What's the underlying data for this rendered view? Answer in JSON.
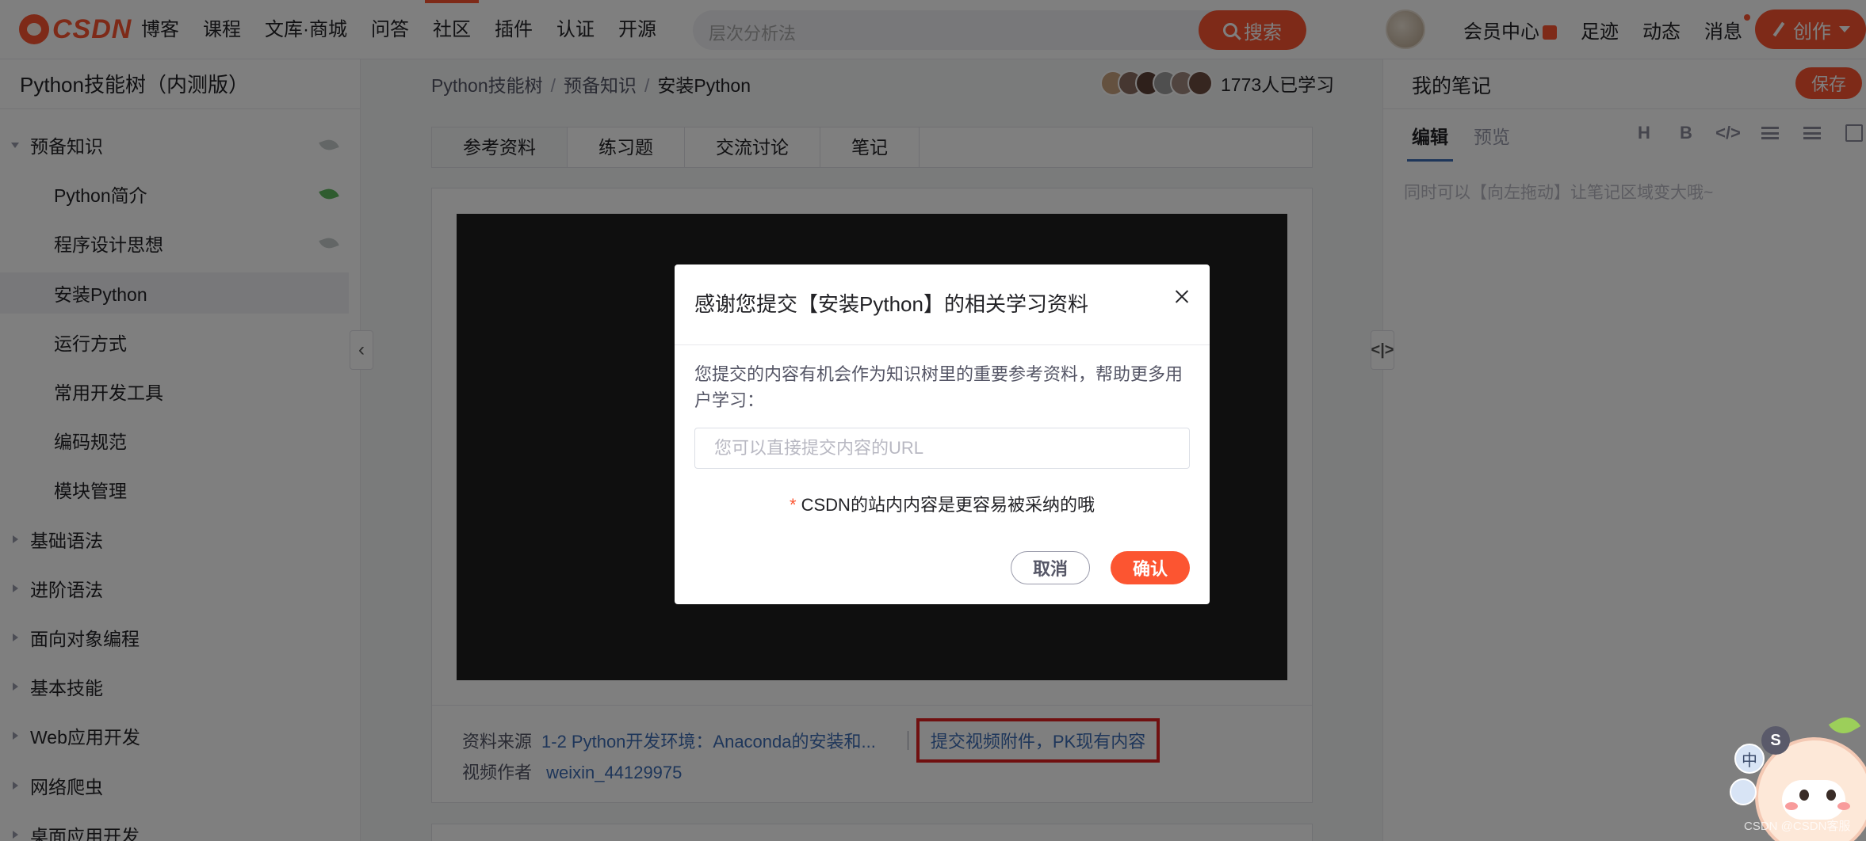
{
  "nav": {
    "logo": "CSDN",
    "links": [
      "博客",
      "课程",
      "文库·商城",
      "问答",
      "社区",
      "插件",
      "认证",
      "开源"
    ],
    "active_link": "社区",
    "search_placeholder": "层次分析法",
    "search_button": "搜索",
    "right_links": [
      "会员中心",
      "足迹",
      "动态",
      "消息"
    ],
    "create_button": "创作"
  },
  "sidebar": {
    "title": "Python技能树（内测版）",
    "items": [
      {
        "label": "预备知识",
        "level": 0,
        "expanded": true,
        "leaf": "grey"
      },
      {
        "label": "Python简介",
        "level": 1,
        "leaf": "green"
      },
      {
        "label": "程序设计思想",
        "level": 1,
        "leaf": "grey"
      },
      {
        "label": "安装Python",
        "level": 1,
        "selected": true
      },
      {
        "label": "运行方式",
        "level": 1
      },
      {
        "label": "常用开发工具",
        "level": 1
      },
      {
        "label": "编码规范",
        "level": 1
      },
      {
        "label": "模块管理",
        "level": 1
      },
      {
        "label": "基础语法",
        "level": 0,
        "expanded": false
      },
      {
        "label": "进阶语法",
        "level": 0,
        "expanded": false
      },
      {
        "label": "面向对象编程",
        "level": 0,
        "expanded": false
      },
      {
        "label": "基本技能",
        "level": 0,
        "expanded": false
      },
      {
        "label": "Web应用开发",
        "level": 0,
        "expanded": false
      },
      {
        "label": "网络爬虫",
        "level": 0,
        "expanded": false
      },
      {
        "label": "桌面应用开发",
        "level": 0,
        "expanded": false
      }
    ]
  },
  "breadcrumb": [
    "Python技能树",
    "预备知识",
    "安装Python"
  ],
  "learners": {
    "count_text": "1773人已学习",
    "avatar_colors": [
      "#c9a27e",
      "#8d6e63",
      "#5d4037",
      "#9e9e9e",
      "#a1887f",
      "#6d4c41"
    ]
  },
  "tabs": [
    "参考资料",
    "练习题",
    "交流讨论",
    "笔记"
  ],
  "active_tab": "参考资料",
  "resource": {
    "source_label": "资料来源",
    "source_link": "1-2 Python开发环境：Anaconda的安装和...",
    "submit_link": "提交视频附件，PK现有内容",
    "author_label": "视频作者",
    "author_link": "weixin_44129975"
  },
  "notes": {
    "title": "我的笔记",
    "save_button": "保存",
    "tab_edit": "编辑",
    "tab_preview": "预览",
    "toolbar": [
      "H",
      "B",
      "</>"
    ],
    "hint": "同时可以【向左拖动】让笔记区域变大哦~"
  },
  "modal": {
    "title": "感谢您提交【安装Python】的相关学习资料",
    "description": "您提交的内容有机会作为知识树里的重要参考资料，帮助更多用户学习：",
    "input_placeholder": "您可以直接提交内容的URL",
    "note_star": "*",
    "note": "CSDN的站内内容是更容易被采纳的哦",
    "cancel": "取消",
    "confirm": "确认"
  },
  "mascot": {
    "badge_s": "S",
    "badge_zh": "中"
  },
  "watermark": "CSDN @CSDN客服",
  "colors": {
    "brand": "#fc5531",
    "link": "#3d6cb5",
    "highlight_box": "#e02020"
  }
}
